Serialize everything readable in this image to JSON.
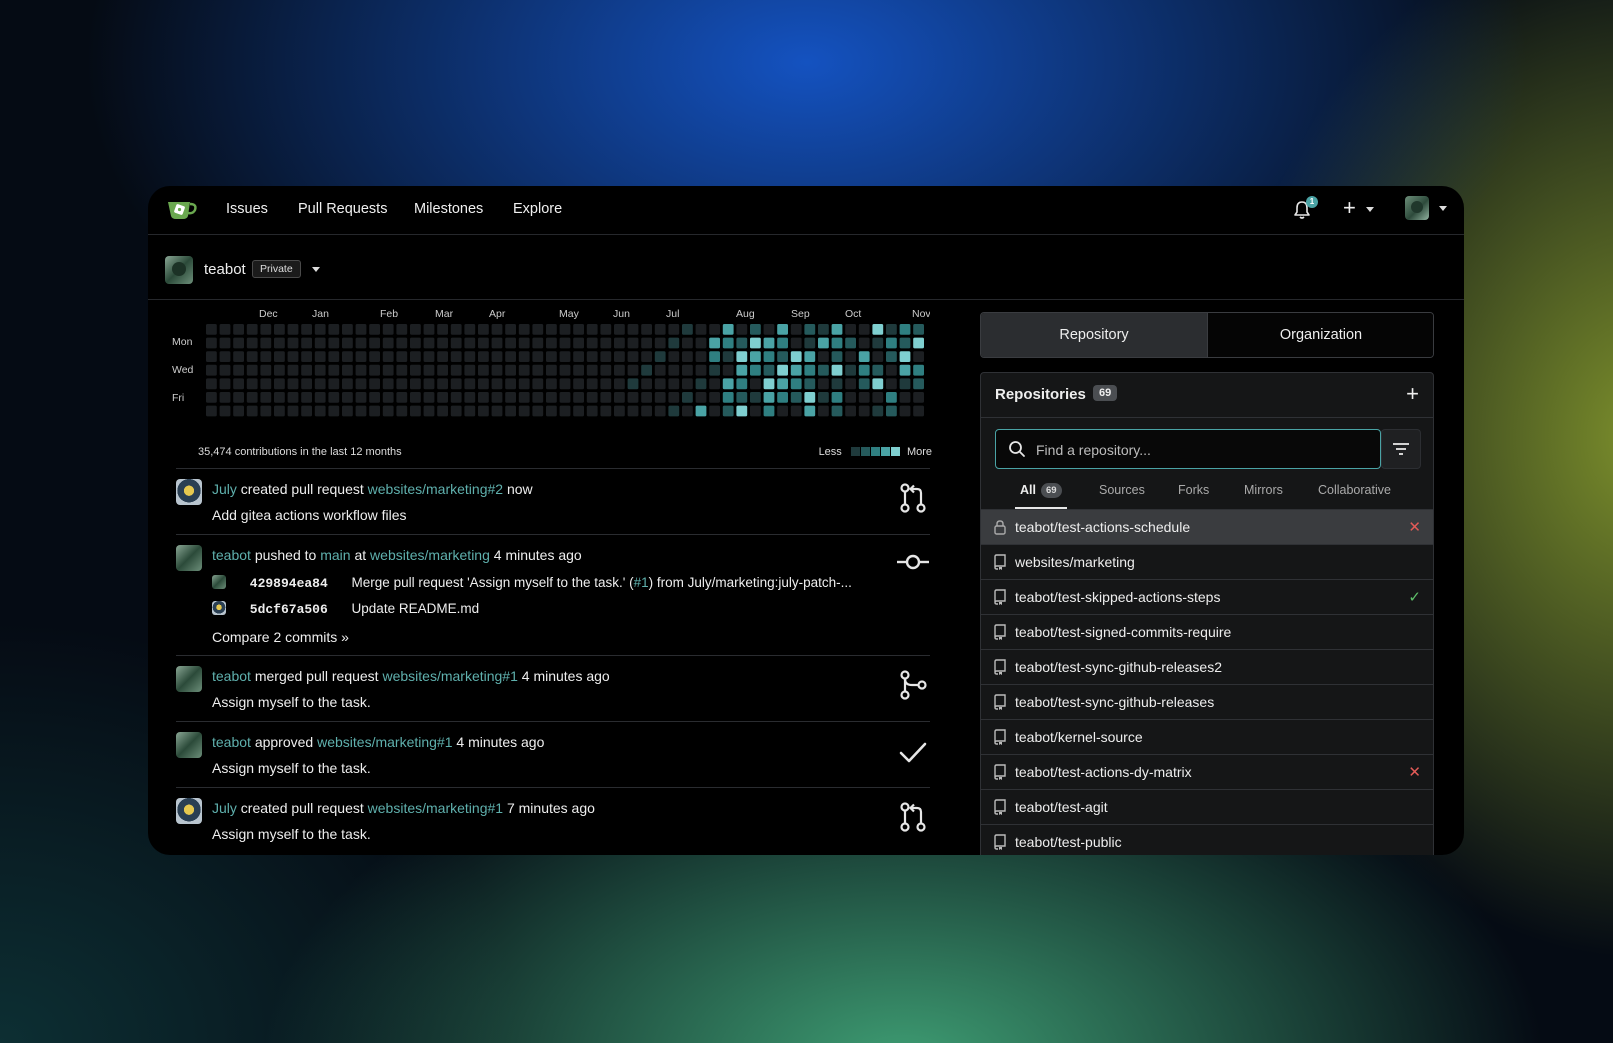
{
  "nav": {
    "links": [
      "Issues",
      "Pull Requests",
      "Milestones",
      "Explore"
    ],
    "notification_count": "1",
    "create_symbol": "+"
  },
  "context": {
    "user": "teabot",
    "visibility": "Private"
  },
  "heatmap": {
    "months": [
      "Dec",
      "Jan",
      "Feb",
      "Mar",
      "Apr",
      "May",
      "Jun",
      "Jul",
      "Aug",
      "Sep",
      "Oct",
      "Nov"
    ],
    "day_labels": [
      "Mon",
      "Wed",
      "Fri"
    ],
    "summary": "35,474 contributions in the last 12 months",
    "legend_less": "Less",
    "legend_more": "More",
    "colors": [
      "#1c1f22",
      "#1f3a3c",
      "#255a5c",
      "#2f7f81",
      "#4aa3a5",
      "#7fcfd0"
    ]
  },
  "feed": {
    "items": [
      {
        "actor": "July",
        "action": "created pull request",
        "target": "websites/marketing#2",
        "time": "now",
        "detail": "Add gitea actions workflow files"
      },
      {
        "actor": "teabot",
        "action": "pushed to",
        "branch": "main",
        "at": "at",
        "target": "websites/marketing",
        "time": "4 minutes ago",
        "commits": [
          {
            "sha": "429894ea84",
            "msg_pre": "Merge pull request 'Assign myself to the task.' (",
            "msg_link": "#1",
            "msg_post": ") from July/marketing:july-patch-..."
          },
          {
            "sha": "5dcf67a506",
            "msg_pre": "Update README.md",
            "msg_link": "",
            "msg_post": ""
          }
        ],
        "compare": "Compare 2 commits »"
      },
      {
        "actor": "teabot",
        "action": "merged pull request",
        "target": "websites/marketing#1",
        "time": "4 minutes ago",
        "detail": "Assign myself to the task."
      },
      {
        "actor": "teabot",
        "action": "approved",
        "target": "websites/marketing#1",
        "time": "4 minutes ago",
        "detail": "Assign myself to the task."
      },
      {
        "actor": "July",
        "action": "created pull request",
        "target": "websites/marketing#1",
        "time": "7 minutes ago",
        "detail": "Assign myself to the task."
      }
    ]
  },
  "panel": {
    "tabs": [
      "Repository",
      "Organization"
    ],
    "title": "Repositories",
    "count": "69",
    "search_placeholder": "Find a repository...",
    "filters": [
      "All",
      "Sources",
      "Forks",
      "Mirrors",
      "Collaborative"
    ],
    "all_count": "69",
    "repos": [
      {
        "name": "teabot/test-actions-schedule",
        "status": "fail",
        "status_icon": "✕",
        "private": true
      },
      {
        "name": "websites/marketing",
        "status": "",
        "status_icon": "",
        "private": false
      },
      {
        "name": "teabot/test-skipped-actions-steps",
        "status": "ok",
        "status_icon": "✓",
        "private": false
      },
      {
        "name": "teabot/test-signed-commits-require",
        "status": "",
        "status_icon": "",
        "private": false
      },
      {
        "name": "teabot/test-sync-github-releases2",
        "status": "",
        "status_icon": "",
        "private": false
      },
      {
        "name": "teabot/test-sync-github-releases",
        "status": "",
        "status_icon": "",
        "private": false
      },
      {
        "name": "teabot/kernel-source",
        "status": "",
        "status_icon": "",
        "private": false
      },
      {
        "name": "teabot/test-actions-dy-matrix",
        "status": "fail",
        "status_icon": "✕",
        "private": false
      },
      {
        "name": "teabot/test-agit",
        "status": "",
        "status_icon": "",
        "private": false
      },
      {
        "name": "teabot/test-public",
        "status": "",
        "status_icon": "",
        "private": false
      }
    ]
  }
}
